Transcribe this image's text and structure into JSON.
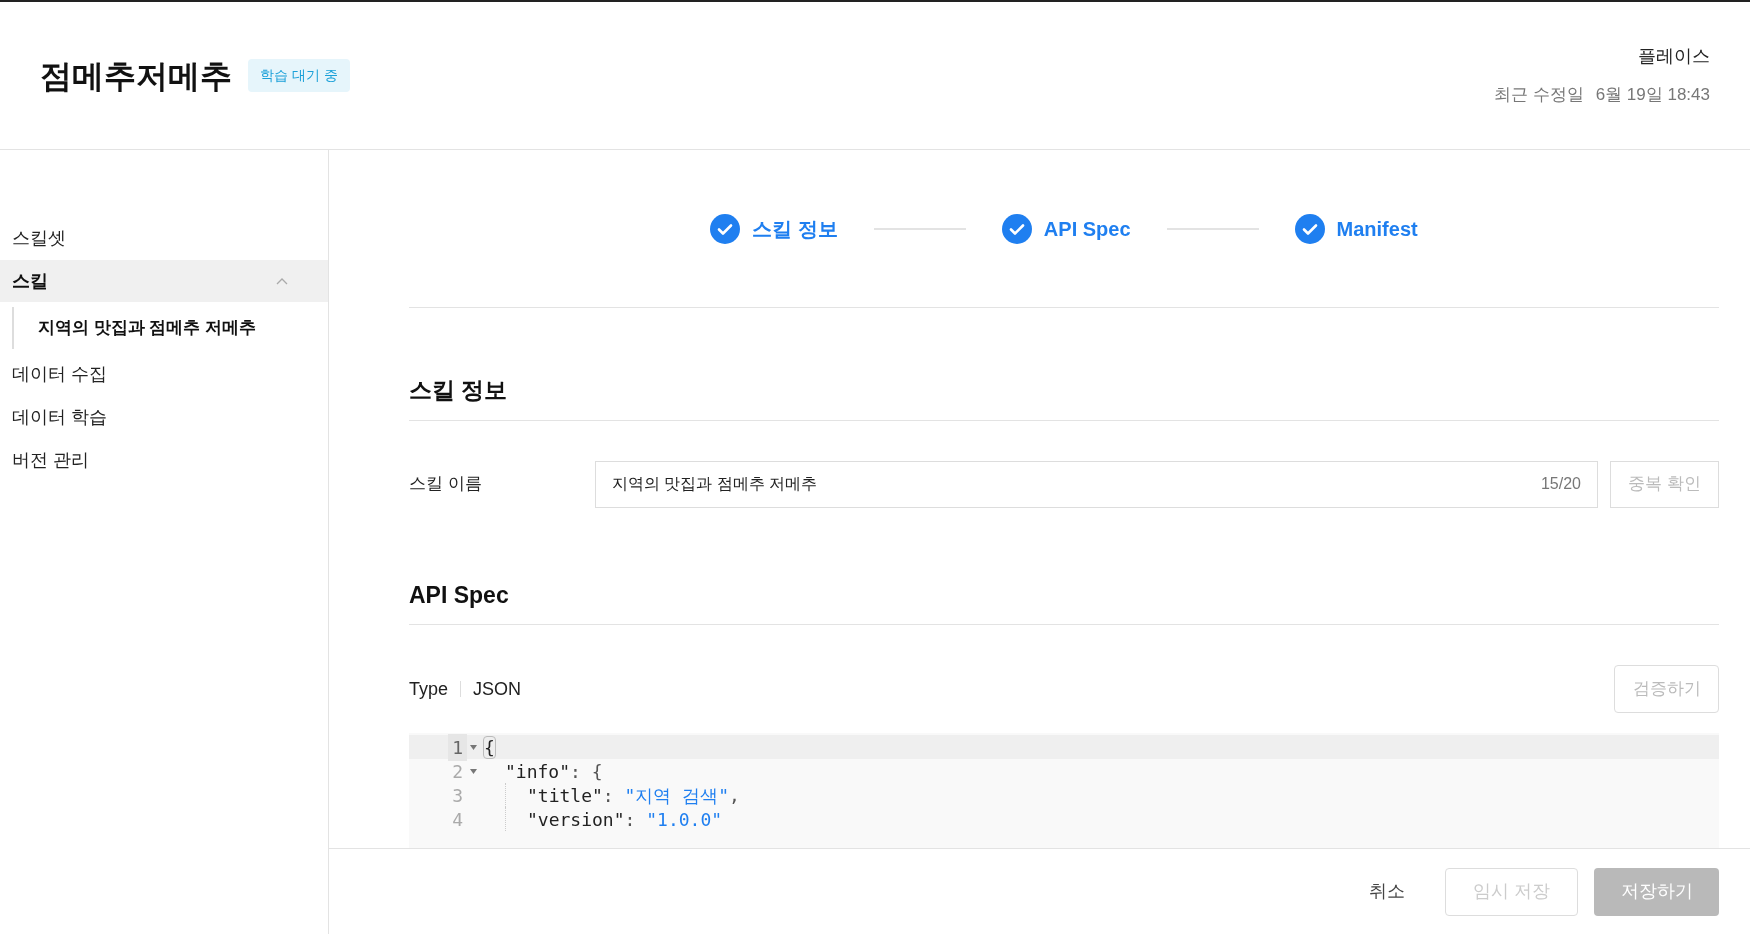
{
  "header": {
    "title": "점메추저메추",
    "status_badge": "학습 대기 중",
    "workspace": "플레이스",
    "modified_label": "최근 수정일",
    "modified_date": "6월 19일 18:43"
  },
  "sidebar": {
    "items": [
      {
        "label": "스킬셋",
        "selected": false
      },
      {
        "label": "스킬",
        "selected": true,
        "expanded": true,
        "children": [
          {
            "label": "지역의 맛집과 점메추 저메추",
            "selected": true
          }
        ]
      },
      {
        "label": "데이터 수집",
        "selected": false
      },
      {
        "label": "데이터 학습",
        "selected": false
      },
      {
        "label": "버전 관리",
        "selected": false
      }
    ]
  },
  "stepper": [
    {
      "label": "스킬 정보",
      "done": true
    },
    {
      "label": "API Spec",
      "done": true
    },
    {
      "label": "Manifest",
      "done": true
    }
  ],
  "skill_info": {
    "heading": "스킬 정보",
    "name_label": "스킬 이름",
    "name_value": "지역의 맛집과 점메추 저메추",
    "counter": "15/20",
    "check_button": {
      "label": "중복 확인",
      "disabled": true
    }
  },
  "api_spec": {
    "heading": "API Spec",
    "type_label": "Type",
    "type_value": "JSON",
    "validate_button": {
      "label": "검증하기",
      "disabled": true
    },
    "code_lines": [
      {
        "number": "1",
        "foldable": true,
        "active": true,
        "tokens": [
          {
            "kind": "bracket",
            "text": "{"
          }
        ],
        "children": [
          {
            "number": "2",
            "foldable": true,
            "active": false,
            "tokens": [
              {
                "kind": "key",
                "text": "\"info\""
              },
              {
                "kind": "punct",
                "text": ": {"
              }
            ],
            "children": [
              {
                "number": "3",
                "foldable": false,
                "active": false,
                "tokens": [
                  {
                    "kind": "key",
                    "text": "\"title\""
                  },
                  {
                    "kind": "punct",
                    "text": ": "
                  },
                  {
                    "kind": "string",
                    "text": "\"지역 검색\""
                  },
                  {
                    "kind": "punct",
                    "text": ","
                  }
                ]
              },
              {
                "number": "4",
                "foldable": false,
                "active": false,
                "tokens": [
                  {
                    "kind": "key",
                    "text": "\"version\""
                  },
                  {
                    "kind": "punct",
                    "text": ": "
                  },
                  {
                    "kind": "string",
                    "text": "\"1.0.0\""
                  }
                ]
              }
            ]
          }
        ]
      }
    ]
  },
  "footer": {
    "buttons": [
      {
        "label": "취소",
        "kind": "text",
        "disabled": false
      },
      {
        "label": "임시 저장",
        "kind": "outline",
        "disabled": true
      },
      {
        "label": "저장하기",
        "kind": "primary",
        "disabled": true
      }
    ]
  }
}
